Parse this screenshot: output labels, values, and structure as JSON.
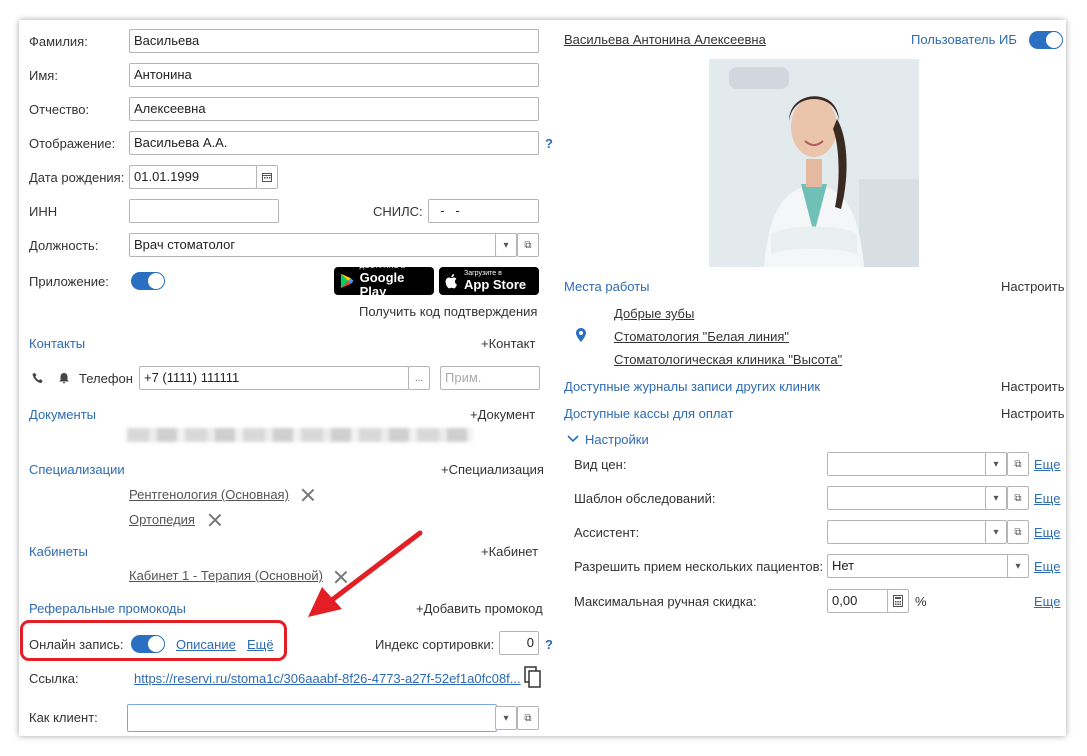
{
  "form": {
    "surname_label": "Фамилия:",
    "surname_value": "Васильева",
    "name_label": "Имя:",
    "name_value": "Антонина",
    "patronymic_label": "Отчество:",
    "patronymic_value": "Алексеевна",
    "display_label": "Отображение:",
    "display_value": "Васильева А.А.",
    "display_help": "?",
    "birth_label": "Дата рождения:",
    "birth_value": "01.01.1999",
    "inn_label": "ИНН",
    "inn_value": "",
    "snils_label": "СНИЛС:",
    "snils_value": "  -   -",
    "position_label": "Должность:",
    "position_value": "Врач стоматолог",
    "app_label": "Приложение:",
    "google_small": "ДОСТУПНО В",
    "google_big": "Google Play",
    "apple_small": "Загрузите в",
    "apple_big": "App Store",
    "get_code": "Получить код подтверждения"
  },
  "contacts": {
    "title": "Контакты",
    "add": "+Контакт",
    "phone_label": "Телефон",
    "phone_value": "+7 (1111) 111111",
    "note_placeholder": "Прим.",
    "more_btn": "..."
  },
  "documents": {
    "title": "Документы",
    "add": "+Документ"
  },
  "specializations": {
    "title": "Специализации",
    "add": "+Специализация",
    "items": [
      "Рентгенология (Основная)",
      "Ортопедия"
    ]
  },
  "cabinets": {
    "title": "Кабинеты",
    "add": "+Кабинет",
    "items": [
      "Кабинет 1 - Терапия (Основной)"
    ]
  },
  "promo": {
    "title": "Реферальные промокоды",
    "add": "+Добавить промокод"
  },
  "online": {
    "label": "Онлайн запись:",
    "description": "Описание",
    "more": "Ещё",
    "sort_label": "Индекс сортировки:",
    "sort_value": "0",
    "sort_help": "?"
  },
  "link": {
    "label": "Ссылка:",
    "url": "https://reservi.ru/stoma1c/306aaabf-8f26-4773-a27f-52ef1a0fc08f..."
  },
  "client": {
    "label": "Как клиент:",
    "value": ""
  },
  "right": {
    "full_name": "Васильева Антонина Алексеевна",
    "ib_user": "Пользователь ИБ",
    "workplaces_title": "Места работы",
    "configure": "Настроить",
    "workplaces": [
      "Добрые зубы",
      "Стоматология \"Белая линия\"",
      "Стоматологическая клиника \"Высота\""
    ],
    "journals": "Доступные журналы записи других клиник",
    "cashboxes": "Доступные кассы для оплат",
    "settings_title": "Настройки",
    "settings": [
      {
        "label": "Вид цен:",
        "value": "",
        "more": "Еще"
      },
      {
        "label": "Шаблон обследований:",
        "value": "",
        "more": "Еще"
      },
      {
        "label": "Ассистент:",
        "value": "",
        "more": "Еще"
      },
      {
        "label": "Разрешить прием нескольких пациентов:",
        "value": "Нет",
        "more": "Еще"
      },
      {
        "label": "Максимальная ручная скидка:",
        "value": "0,00",
        "unit": "%",
        "more": "Еще"
      }
    ]
  },
  "colors": {
    "accent": "#2a6fc1",
    "link": "#2d6bb3",
    "annotation": "#e31e24"
  }
}
